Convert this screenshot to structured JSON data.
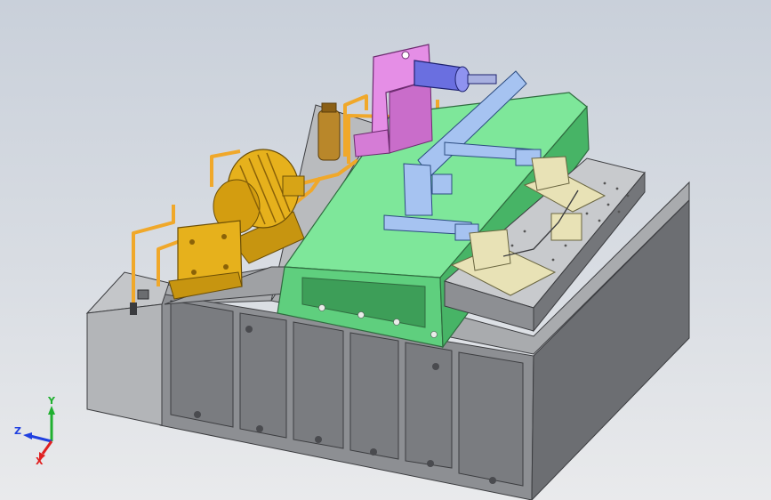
{
  "viewport": {
    "background_top": "#c9d0da",
    "background_bottom": "#e9eaec"
  },
  "model": {
    "colors": {
      "base_gray": "#8d8f93",
      "base_dark": "#5a5c60",
      "table_green": "#7ee79a",
      "table_green_dark": "#3d9e58",
      "motor_yellow": "#e6b11c",
      "pipe_orange": "#f0a82a",
      "pink_bracket": "#e58ee6",
      "cylinder_blue": "#6a6fe0",
      "arm_blue": "#a6c3f1",
      "fixture_cream": "#e8e2b6",
      "plate_gray": "#b8babd",
      "tank_gray": "#b3b5b8",
      "accumulator_brown": "#b9872a"
    }
  },
  "triad": {
    "x_label": "X",
    "y_label": "Y",
    "z_label": "Z",
    "x_color": "#e02020",
    "y_color": "#20b030",
    "z_color": "#2040e0"
  }
}
